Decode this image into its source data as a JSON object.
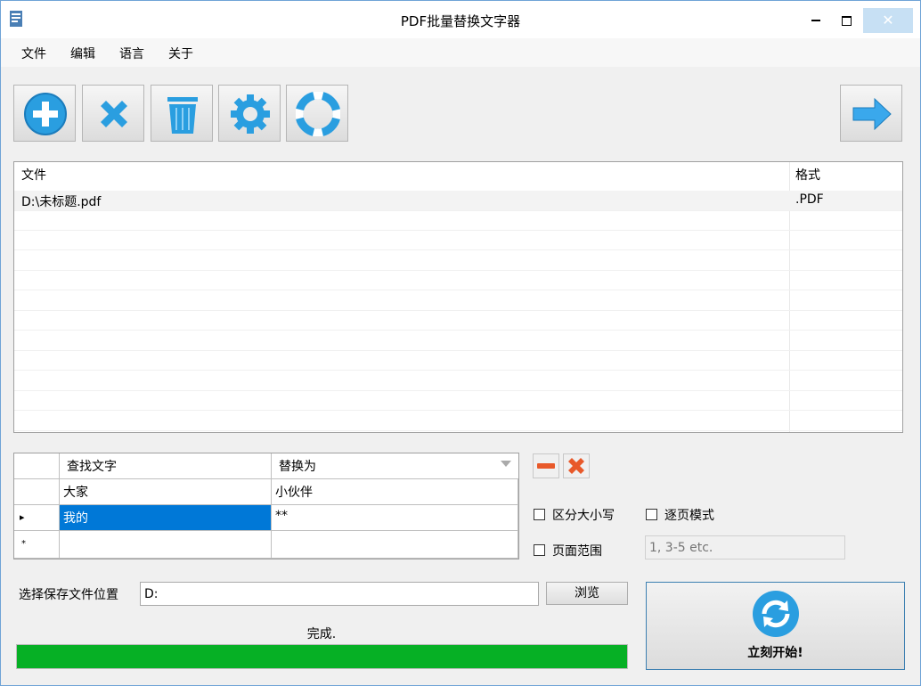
{
  "window": {
    "title": "PDF批量替换文字器"
  },
  "menu": [
    "文件",
    "编辑",
    "语言",
    "关于"
  ],
  "toolbar": {
    "buttons": [
      "add-icon",
      "remove-icon",
      "trash-icon",
      "settings-icon",
      "help-lifebuoy-icon"
    ],
    "next": "arrow-right-icon"
  },
  "files": {
    "headers": {
      "file": "文件",
      "format": "格式"
    },
    "rows": [
      {
        "file": "D:\\未标题.pdf",
        "format": ".PDF"
      }
    ]
  },
  "replace": {
    "headers": {
      "find": "查找文字",
      "replace": "替换为"
    },
    "rows": [
      {
        "marker": "",
        "find": "大家",
        "replace": "小伙伴"
      },
      {
        "marker": "▸",
        "find": "我的",
        "replace": "**"
      },
      {
        "marker": "*",
        "find": "",
        "replace": ""
      }
    ]
  },
  "options": {
    "case_sensitive": "区分大小写",
    "page_by_page": "逐页模式",
    "page_range": "页面范围",
    "page_range_placeholder": "1, 3-5 etc."
  },
  "save": {
    "label": "选择保存文件位置",
    "value": "D:",
    "browse": "浏览"
  },
  "status": {
    "text": "完成.",
    "progress": 1.0
  },
  "start": {
    "label": "立刻开始!"
  },
  "colors": {
    "accent": "#2a9ee0",
    "selection": "#0078d7",
    "progress": "#06b025",
    "remove": "#e8592a"
  }
}
